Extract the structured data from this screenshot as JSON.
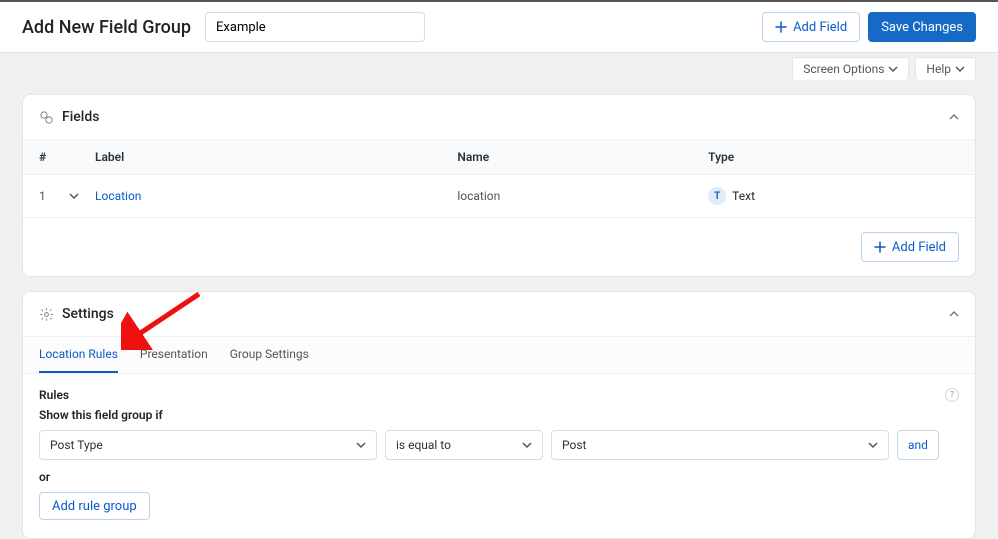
{
  "header": {
    "page_title": "Add New Field Group",
    "title_value": "Example",
    "add_field_label": "Add Field",
    "save_label": "Save Changes"
  },
  "screen_options": {
    "screen_label": "Screen Options",
    "help_label": "Help"
  },
  "fields_panel": {
    "title": "Fields",
    "columns": {
      "num": "#",
      "label": "Label",
      "name": "Name",
      "type": "Type"
    },
    "row": {
      "num": "1",
      "label": "Location",
      "name": "location",
      "type_badge": "T",
      "type_text": "Text"
    },
    "footer_add_label": "Add Field"
  },
  "settings_panel": {
    "title": "Settings",
    "tabs": {
      "location": "Location Rules",
      "presentation": "Presentation",
      "group": "Group Settings"
    },
    "rules_label": "Rules",
    "show_if_label": "Show this field group if",
    "rule": {
      "param": "Post Type",
      "operator": "is equal to",
      "value": "Post",
      "and_label": "and"
    },
    "or_label": "or",
    "add_group_label": "Add rule group"
  }
}
